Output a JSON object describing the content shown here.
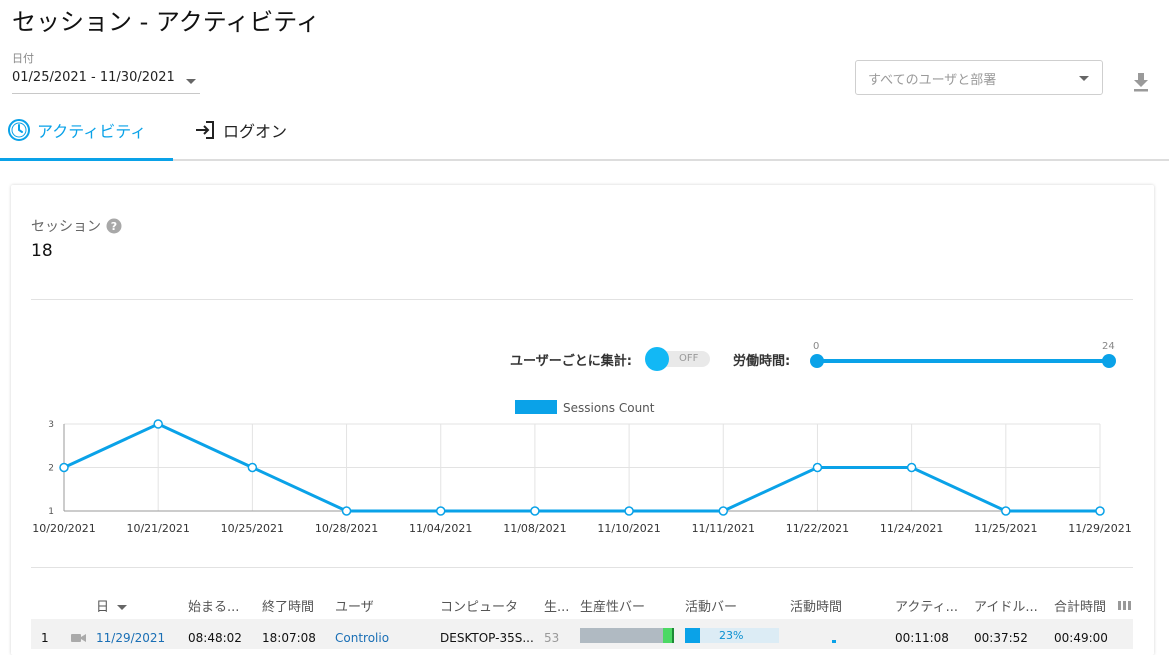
{
  "page": {
    "title": "セッション - アクティビティ",
    "date_label": "日付",
    "date_range": "01/25/2021 - 11/30/2021",
    "user_filter_placeholder": "すべてのユーザと部署"
  },
  "tabs": [
    {
      "label": "アクティビティ",
      "active": true
    },
    {
      "label": "ログオン",
      "active": false
    }
  ],
  "summary": {
    "label": "セッション",
    "value": "18"
  },
  "controls": {
    "aggregate_label": "ユーザーごとに集計:",
    "toggle_state": "OFF",
    "work_hours_label": "労働時間:",
    "slider_min": "0",
    "slider_max": "24"
  },
  "chart_data": {
    "type": "line",
    "categories": [
      "10/20/2021",
      "10/21/2021",
      "10/25/2021",
      "10/28/2021",
      "11/04/2021",
      "11/08/2021",
      "11/10/2021",
      "11/11/2021",
      "11/22/2021",
      "11/24/2021",
      "11/25/2021",
      "11/29/2021"
    ],
    "series": [
      {
        "name": "Sessions Count",
        "values": [
          2,
          3,
          2,
          1,
          1,
          1,
          1,
          1,
          2,
          2,
          1,
          1
        ],
        "color": "#0aa2e8"
      }
    ],
    "y_ticks": [
      1,
      2,
      3
    ],
    "ylim": [
      1,
      3
    ],
    "grid": true,
    "legend_position": "top-center"
  },
  "table": {
    "headers": [
      "日",
      "始まる...",
      "終了時間",
      "ユーザ",
      "コンピュータ",
      "生...",
      "生産性バー",
      "活動バー",
      "活動時間",
      "アクティ...",
      "アイドル...",
      "合計時間"
    ],
    "rows": [
      {
        "index": "1",
        "date": "11/29/2021",
        "start": "08:48:02",
        "end": "18:07:08",
        "user": "Controlio",
        "computer": "DESKTOP-35S...",
        "productivity": "53",
        "productivity_fraction": 0.53,
        "activity_percent": "23%",
        "activity_fraction": 0.23,
        "active": "00:11:08",
        "idle": "00:37:52",
        "total": "00:49:00"
      }
    ]
  },
  "colors": {
    "accent": "#0aa2e8",
    "link": "#1a6fb5",
    "productive_green": "#4cd964"
  }
}
